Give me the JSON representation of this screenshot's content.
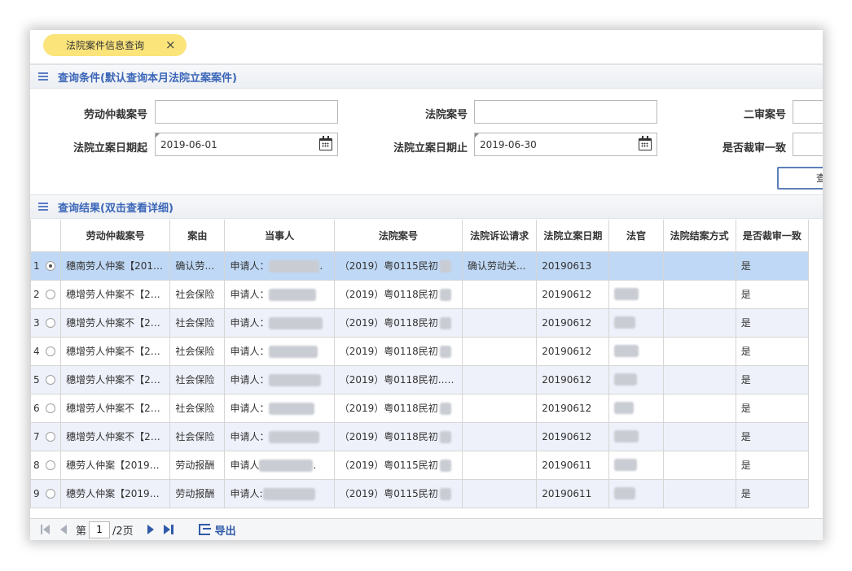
{
  "tab": {
    "label": "法院案件信息查询",
    "close": "×"
  },
  "query_section": {
    "title": "查询条件(默认查询本月法院立案案件)",
    "labels": {
      "arbitration_no": "劳动仲裁案号",
      "court_no": "法院案号",
      "second_no": "二审案号",
      "date_from": "法院立案日期起",
      "date_to": "法院立案日期止",
      "consistent": "是否裁审一致"
    },
    "values": {
      "date_from": "2019-06-01",
      "date_to": "2019-06-30"
    },
    "query_button": "查"
  },
  "result_section": {
    "title": "查询结果(双击查看详细)"
  },
  "table": {
    "columns": [
      "劳动仲裁案号",
      "案由",
      "当事人",
      "法院案号",
      "法院诉讼请求",
      "法院立案日期",
      "法官",
      "法院结案方式",
      "是否裁审一致"
    ],
    "rows": [
      {
        "index": "1",
        "selected": true,
        "arbitration_no": "穗南劳人仲案【2019】...",
        "cause": "确认劳动关...",
        "party": "申请人：",
        "party_tail": ".",
        "court_no": "（2019）粤0115民初",
        "claim": "确认劳动关...",
        "date": "20190613",
        "consistent": "是"
      },
      {
        "index": "2",
        "selected": false,
        "arbitration_no": "穗增劳人仲案不【20...",
        "cause": "社会保险",
        "party": "申请人：",
        "party_tail": "",
        "court_no": "（2019）粤0118民初",
        "claim": "",
        "date": "20190612",
        "consistent": "是"
      },
      {
        "index": "3",
        "selected": false,
        "arbitration_no": "穗增劳人仲案不【20...",
        "cause": "社会保险",
        "party": "申请人：",
        "party_tail": "",
        "court_no": "（2019）粤0118民初",
        "claim": "",
        "date": "20190612",
        "consistent": "是"
      },
      {
        "index": "4",
        "selected": false,
        "arbitration_no": "穗增劳人仲案不【20...",
        "cause": "社会保险",
        "party": "申请人：",
        "party_tail": "",
        "court_no": "（2019）粤0118民初",
        "claim": "",
        "date": "20190612",
        "consistent": "是"
      },
      {
        "index": "5",
        "selected": false,
        "arbitration_no": "穗增劳人仲案不【20...",
        "cause": "社会保险",
        "party": "申请人：",
        "party_tail": "",
        "court_no": "（2019）粤0118民初...",
        "claim": "",
        "date": "20190612",
        "consistent": "是"
      },
      {
        "index": "6",
        "selected": false,
        "arbitration_no": "穗增劳人仲案不【20...",
        "cause": "社会保险",
        "party": "申请人：",
        "party_tail": "",
        "court_no": "（2019）粤0118民初",
        "claim": "",
        "date": "20190612",
        "consistent": "是"
      },
      {
        "index": "7",
        "selected": false,
        "arbitration_no": "穗增劳人仲案不【20...",
        "cause": "社会保险",
        "party": "申请人：",
        "party_tail": "",
        "court_no": "（2019）粤0118民初",
        "claim": "",
        "date": "20190612",
        "consistent": "是"
      },
      {
        "index": "8",
        "selected": false,
        "arbitration_no": "穗劳人仲案【2019】...",
        "cause": "劳动报酬",
        "party": "申请人",
        "party_tail": ".",
        "court_no": "（2019）粤0115民初",
        "claim": "",
        "date": "20190611",
        "consistent": "是"
      },
      {
        "index": "9",
        "selected": false,
        "arbitration_no": "穗劳人仲案【2019】...",
        "cause": "劳动报酬",
        "party": "申请人:",
        "party_tail": "",
        "court_no": "（2019）粤0115民初",
        "claim": "",
        "date": "20190611",
        "consistent": "是"
      }
    ]
  },
  "pager": {
    "prefix": "第",
    "page": "1",
    "suffix": "/2页",
    "export": "导出"
  }
}
